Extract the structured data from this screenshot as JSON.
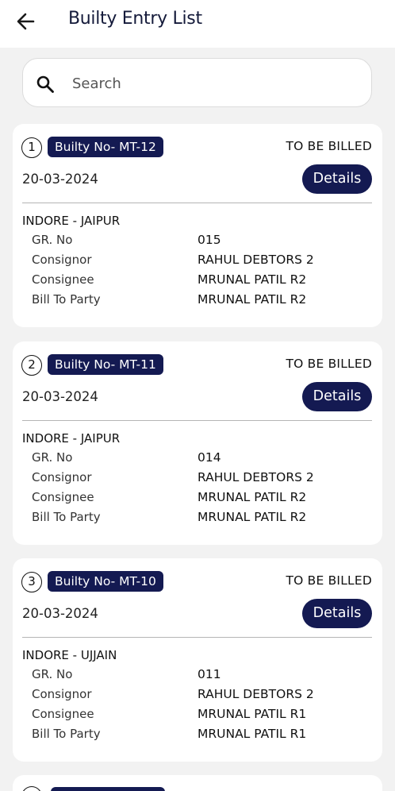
{
  "header": {
    "title": "Builty Entry List",
    "back_icon": "arrow-left-icon"
  },
  "search": {
    "placeholder": "Search",
    "icon": "search-icon"
  },
  "labels": {
    "gr_no": "GR. No",
    "consignor": "Consignor",
    "consignee": "Consignee",
    "bill_to_party": "Bill To Party",
    "details": "Details"
  },
  "colors": {
    "accent": "#141a52",
    "background": "#f2f2f2",
    "card": "#ffffff"
  },
  "entries": [
    {
      "index": "1",
      "builty_no": "Builty No- MT-12",
      "status": "TO BE BILLED",
      "date": "20-03-2024",
      "route": "INDORE - JAIPUR",
      "gr_no": "015",
      "consignor": "RAHUL DEBTORS 2",
      "consignee": "MRUNAL PATIL R2",
      "bill_to_party": "MRUNAL PATIL R2"
    },
    {
      "index": "2",
      "builty_no": "Builty No- MT-11",
      "status": "TO BE BILLED",
      "date": "20-03-2024",
      "route": "INDORE - JAIPUR",
      "gr_no": "014",
      "consignor": "RAHUL DEBTORS 2",
      "consignee": "MRUNAL PATIL R2",
      "bill_to_party": "MRUNAL PATIL R2"
    },
    {
      "index": "3",
      "builty_no": "Builty No- MT-10",
      "status": "TO BE BILLED",
      "date": "20-03-2024",
      "route": "INDORE - UJJAIN",
      "gr_no": "011",
      "consignor": "RAHUL DEBTORS 2",
      "consignee": "MRUNAL PATIL R1",
      "bill_to_party": "MRUNAL PATIL R1"
    }
  ]
}
